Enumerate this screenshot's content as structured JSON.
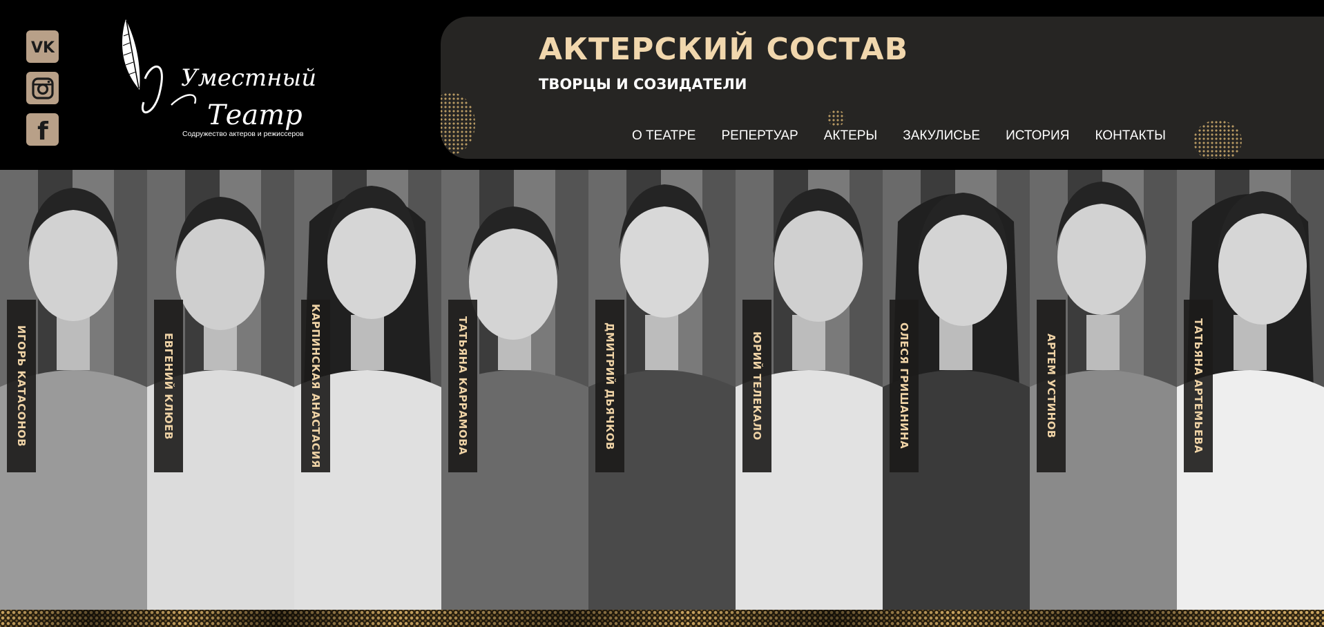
{
  "social": {
    "items": [
      {
        "name": "vk-icon",
        "glyph": "VK"
      },
      {
        "name": "instagram-icon",
        "glyph": ""
      },
      {
        "name": "facebook-icon",
        "glyph": "f"
      }
    ],
    "icon_bg": "#b8a088",
    "icon_fg": "#1b1b1b"
  },
  "logo": {
    "line1": "Уместный",
    "line2": "Театр",
    "tagline": "Содружество актеров и режиссеров"
  },
  "header": {
    "title": "АКТЕРСКИЙ СОСТАВ",
    "subtitle": "ТВОРЦЫ И СОЗИДАТЕЛИ"
  },
  "nav": {
    "items": [
      {
        "label": "О ТЕАТРЕ"
      },
      {
        "label": "РЕПЕРТУАР"
      },
      {
        "label": "АКТЕРЫ"
      },
      {
        "label": "ЗАКУЛИСЬЕ"
      },
      {
        "label": "ИСТОРИЯ"
      },
      {
        "label": "КОНТАКТЫ"
      }
    ]
  },
  "cast": [
    {
      "name": "ИГОРЬ КАТАСОНОВ"
    },
    {
      "name": "ЕВГЕНИЙ КЛЮЕВ"
    },
    {
      "name": "КАРПИНСКАЯ АНАСТАСИЯ"
    },
    {
      "name": "ТАТЬЯНА КАРРАМОВА"
    },
    {
      "name": "ДМИТРИЙ ДЬЯЧКОВ"
    },
    {
      "name": "ЮРИЙ ТЕЛЕКАЛО"
    },
    {
      "name": "ОЛЕСЯ ГРИШАНИНА"
    },
    {
      "name": "АРТЕМ УСТИНОВ"
    },
    {
      "name": "ТАТЬЯНА АРТЕМЬЕВА"
    }
  ],
  "colors": {
    "accent": "#f1d7ad",
    "panel": "#262523",
    "background": "#000000"
  }
}
